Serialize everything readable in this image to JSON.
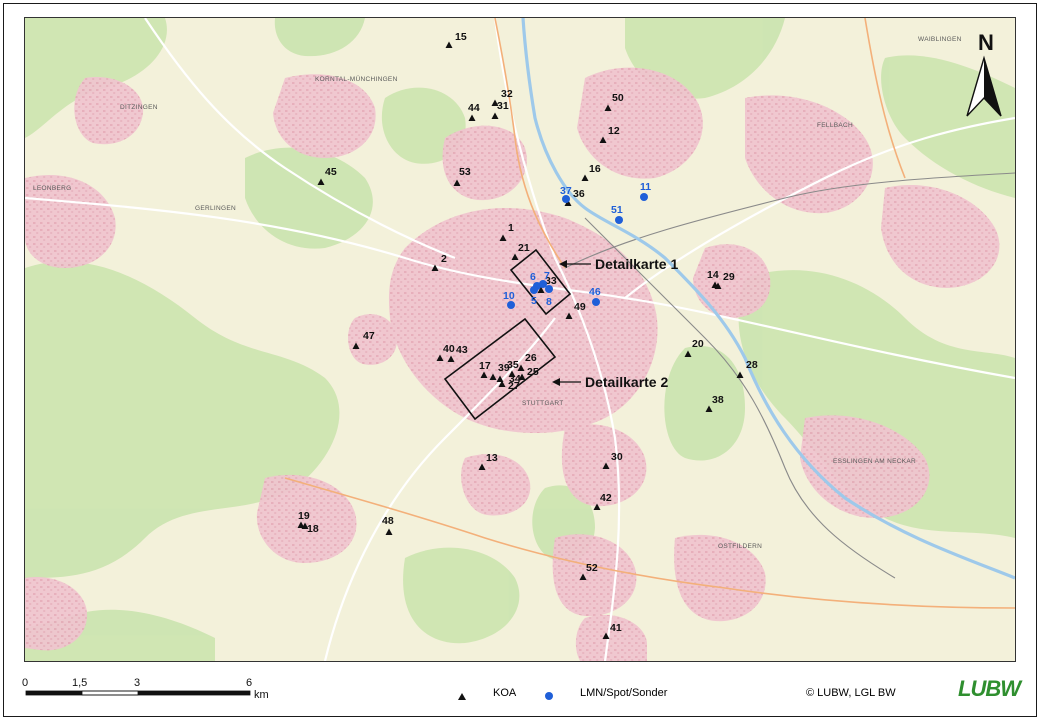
{
  "map": {
    "north_label": "N",
    "detail_labels": [
      "Detailkarte 1",
      "Detailkarte 2"
    ],
    "town_labels": [
      "KORNTAL-MÜNCHINGEN",
      "DITZINGEN",
      "LEONBERG",
      "GERLINGEN",
      "WAIBLINGEN",
      "FELLBACH",
      "STUTTGART",
      "ESSLINGEN AM NECKAR",
      "OSTFILDERN"
    ],
    "koa_points": [
      "15",
      "32",
      "44",
      "31",
      "50",
      "12",
      "16",
      "53",
      "45",
      "36",
      "1",
      "21",
      "2",
      "14",
      "29",
      "33",
      "49",
      "47",
      "40",
      "43",
      "17",
      "39",
      "35",
      "26",
      "25",
      "34",
      "27",
      "20",
      "28",
      "38",
      "13",
      "30",
      "42",
      "19",
      "18",
      "48",
      "52",
      "41"
    ],
    "lmn_points": [
      "37",
      "11",
      "51",
      "6",
      "7",
      "10",
      "5",
      "8",
      "46"
    ],
    "colors": {
      "koa": "#111111",
      "lmn": "#1f5fd8",
      "urban": "#f2c8d2",
      "forest": "#cfe6b4",
      "field": "#f4f1dd"
    }
  },
  "legend": {
    "scale_ticks": [
      "0",
      "1,5",
      "3",
      "6"
    ],
    "scale_unit": "km",
    "koa_label": "KOA",
    "lmn_label": "LMN/Spot/Sonder",
    "copyright": "© LUBW, LGL BW",
    "logo": "LUBW"
  }
}
